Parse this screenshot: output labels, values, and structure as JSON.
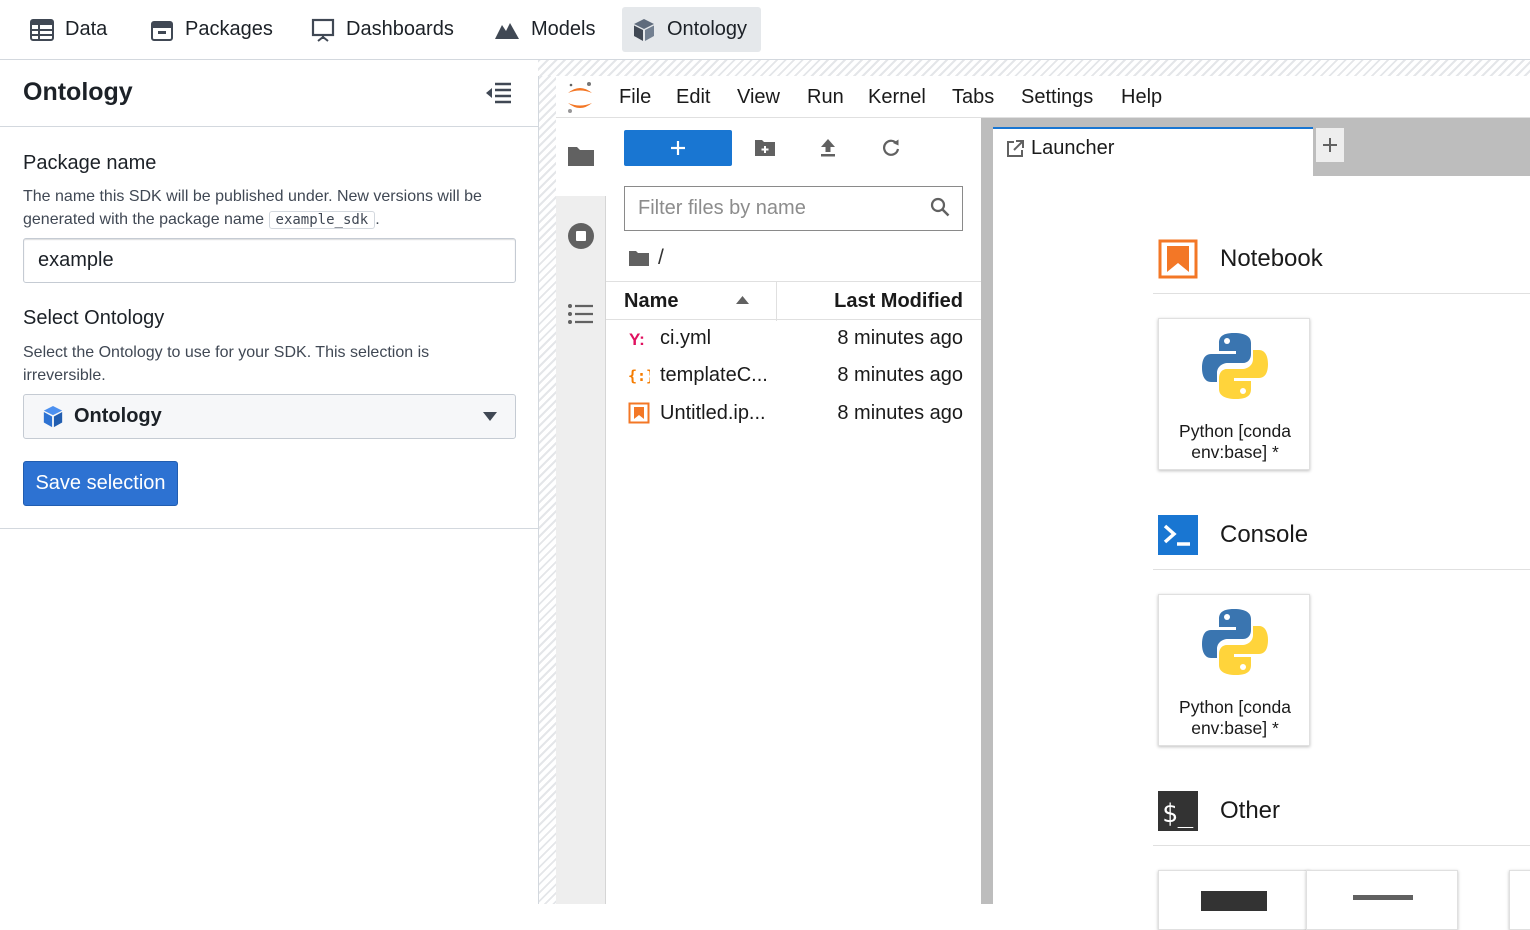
{
  "nav": {
    "tabs": [
      {
        "label": "Data",
        "icon": "table-icon"
      },
      {
        "label": "Packages",
        "icon": "package-icon"
      },
      {
        "label": "Dashboards",
        "icon": "presentation-icon"
      },
      {
        "label": "Models",
        "icon": "mountain-icon"
      },
      {
        "label": "Ontology",
        "icon": "cube-icon",
        "active": true
      }
    ]
  },
  "panel": {
    "title": "Ontology",
    "package_name_label": "Package name",
    "package_help_prefix": "The name this SDK will be published under. New versions will be generated with the package name",
    "package_help_code": "example_sdk",
    "package_help_suffix": ".",
    "package_name_value": "example",
    "select_label": "Select Ontology",
    "select_help": "Select the Ontology to use for your SDK. This selection is irreversible.",
    "select_value": "Ontology",
    "save_label": "Save selection"
  },
  "jupyter": {
    "menu": [
      "File",
      "Edit",
      "View",
      "Run",
      "Kernel",
      "Tabs",
      "Settings",
      "Help"
    ],
    "filter_placeholder": "Filter files by name",
    "breadcrumb": "/",
    "columns": {
      "name": "Name",
      "modified": "Last Modified"
    },
    "files": [
      {
        "name": "ci.yml",
        "modified": "8 minutes ago",
        "icon": "yaml-icon"
      },
      {
        "name": "templateC...",
        "modified": "8 minutes ago",
        "icon": "json-icon"
      },
      {
        "name": "Untitled.ip...",
        "modified": "8 minutes ago",
        "icon": "notebook-icon"
      }
    ],
    "tab_title": "Launcher",
    "launcher": {
      "notebook_title": "Notebook",
      "notebook_kernel_1": "Python [conda",
      "notebook_kernel_2": "env:base] *",
      "console_title": "Console",
      "console_kernel_1": "Python [conda",
      "console_kernel_2": "env:base] *",
      "other_title": "Other"
    }
  },
  "colors": {
    "accent_blue": "#2d72d2",
    "jupyter_blue": "#1976d2",
    "jupyter_orange": "#f37726",
    "yaml_red": "#e0115f"
  }
}
